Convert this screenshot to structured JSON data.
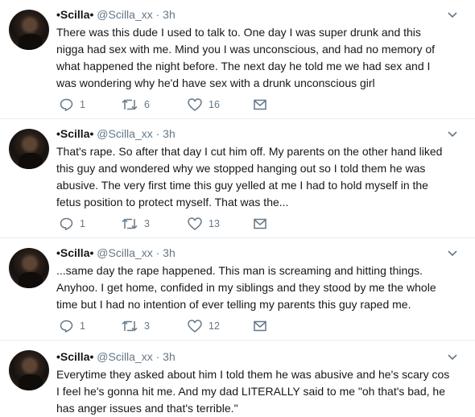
{
  "tweets": [
    {
      "name": "•Scilla•",
      "handle": "@Scilla_xx",
      "time": "· 3h",
      "text": "There was this dude I used to talk to. One day I was super drunk and this nigga had sex with me. Mind you I was unconscious, and had no memory of what happened the night before. The next day he told me we had sex and I was wondering why he'd have sex with a drunk unconscious girl",
      "replies": "1",
      "retweets": "6",
      "likes": "16"
    },
    {
      "name": "•Scilla•",
      "handle": "@Scilla_xx",
      "time": "· 3h",
      "text": "That's rape. So after that day I cut him off. My parents on the other hand liked this guy and wondered why we stopped hanging out so I told them he was abusive. The very first time this guy yelled at me I had to hold myself in the fetus position to protect myself. That was the...",
      "replies": "1",
      "retweets": "3",
      "likes": "13"
    },
    {
      "name": "•Scilla•",
      "handle": "@Scilla_xx",
      "time": "· 3h",
      "text": "...same day the rape happened. This man is screaming and hitting things. Anyhoo. I get home, confided in my siblings and they stood by me the whole time but I had no intention of ever telling my parents this guy raped me.",
      "replies": "1",
      "retweets": "3",
      "likes": "12"
    },
    {
      "name": "•Scilla•",
      "handle": "@Scilla_xx",
      "time": "· 3h",
      "text": "Everytime they asked about him I told them he was abusive and he's scary cos I feel he's gonna hit me. And my dad LITERALLY said to me \"oh that's bad, he has anger issues and that's terrible.\""
    }
  ],
  "icons": {
    "reply": "reply-icon",
    "retweet": "retweet-icon",
    "like": "heart-icon",
    "message": "envelope-icon",
    "more": "chevron-down-icon"
  },
  "colors": {
    "text": "#14171a",
    "secondary": "#657786",
    "divider": "#e6ecf0"
  }
}
